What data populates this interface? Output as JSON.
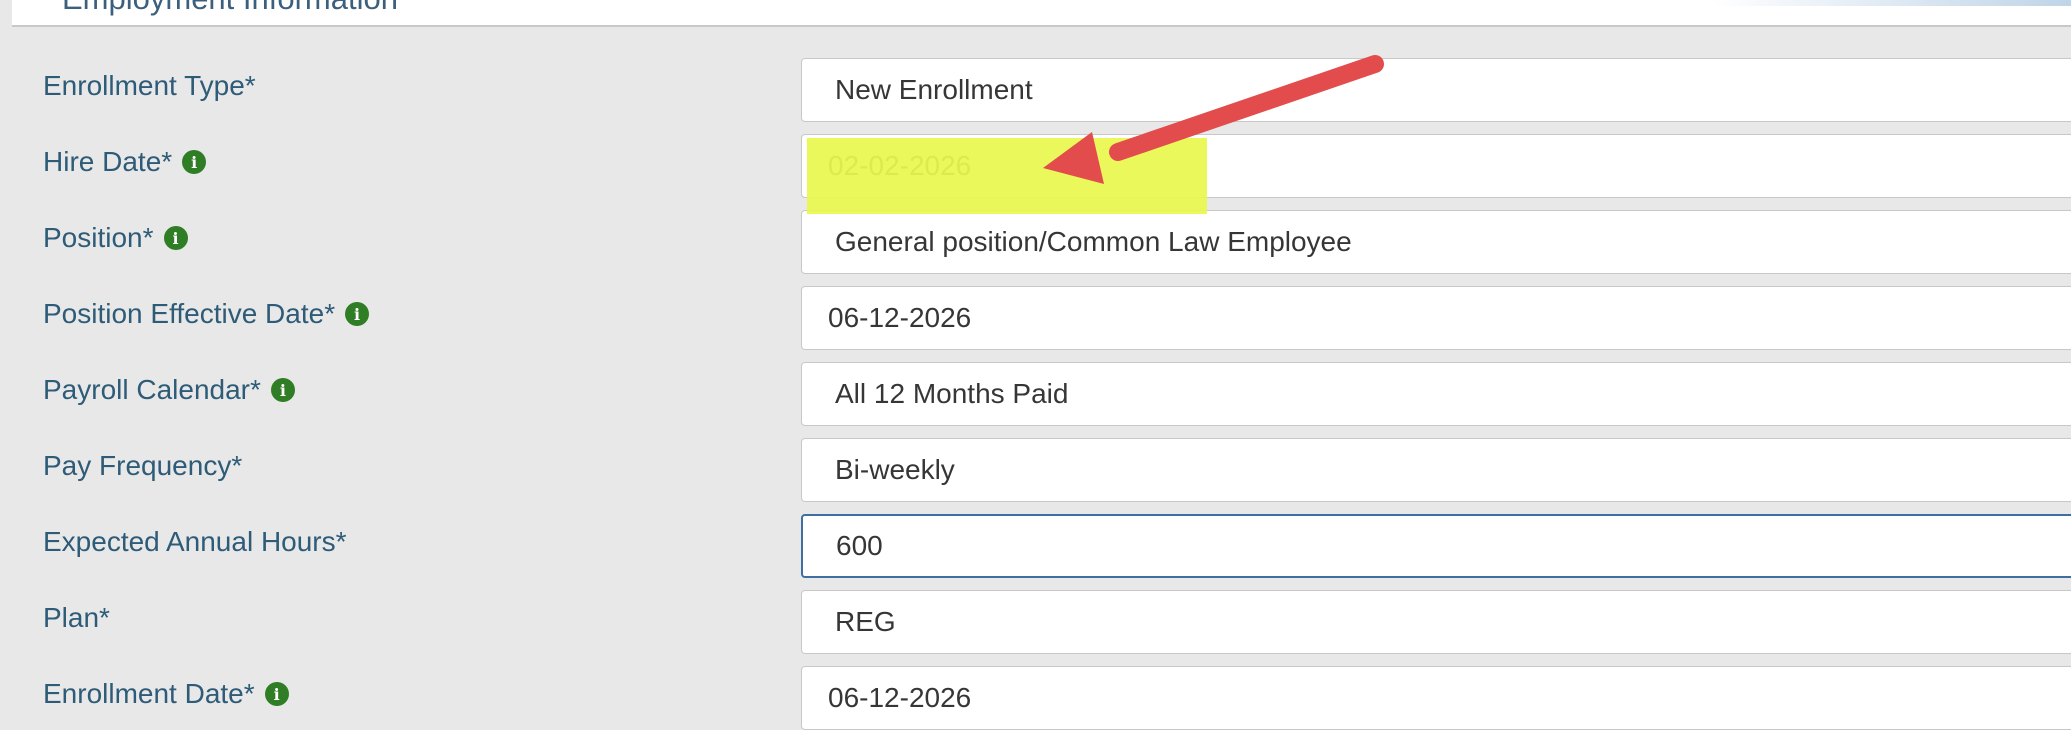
{
  "section": {
    "title": "Employment Information"
  },
  "form": {
    "fields": [
      {
        "label": "Enrollment Type*",
        "value": "New Enrollment"
      },
      {
        "label": "Hire Date*",
        "value": "02-02-2026"
      },
      {
        "label": "Position*",
        "value": "General position/Common Law Employee"
      },
      {
        "label": "Position Effective Date*",
        "value": "06-12-2026"
      },
      {
        "label": "Payroll Calendar*",
        "value": "All 12 Months Paid"
      },
      {
        "label": "Pay Frequency*",
        "value": "Bi-weekly"
      },
      {
        "label": "Expected Annual Hours*",
        "value": "600"
      },
      {
        "label": "Plan*",
        "value": "REG"
      },
      {
        "label": "Enrollment Date*",
        "value": "06-12-2026"
      }
    ]
  },
  "icons": {
    "info": "info-icon",
    "arrow": "red-arrow-icon"
  },
  "colors": {
    "label": "#2e5b77",
    "info": "#2f7d24",
    "highlight": "#e8f84f",
    "arrow": "#e34c4c"
  }
}
